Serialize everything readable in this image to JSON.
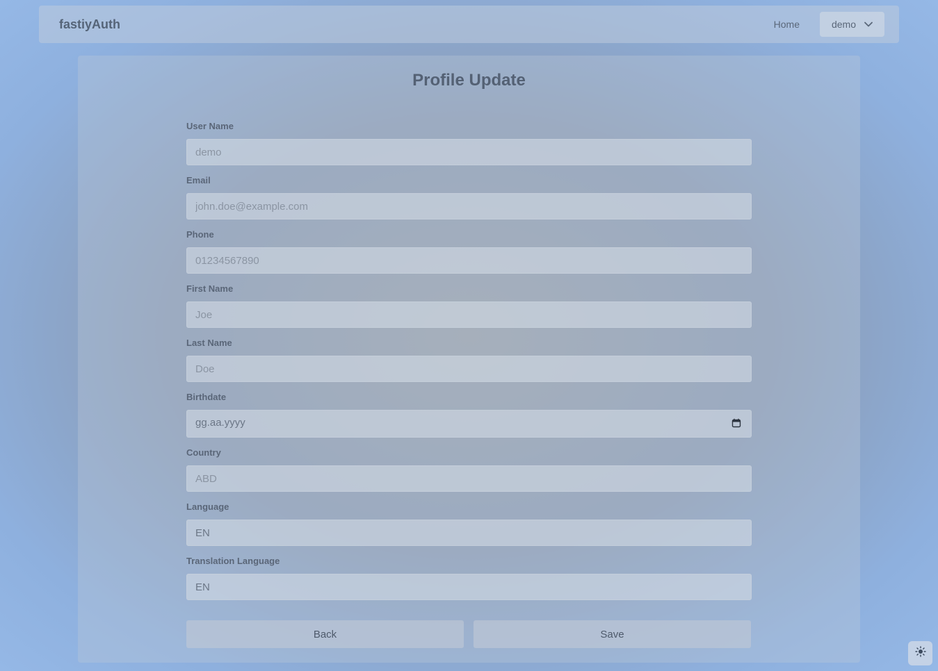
{
  "navbar": {
    "brand": "fastiyAuth",
    "home_label": "Home",
    "user_label": "demo"
  },
  "page": {
    "title": "Profile Update"
  },
  "form": {
    "username": {
      "label": "User Name",
      "placeholder": "demo"
    },
    "email": {
      "label": "Email",
      "placeholder": "john.doe@example.com"
    },
    "phone": {
      "label": "Phone",
      "placeholder": "01234567890"
    },
    "first_name": {
      "label": "First Name",
      "placeholder": "Joe"
    },
    "last_name": {
      "label": "Last Name",
      "placeholder": "Doe"
    },
    "birthdate": {
      "label": "Birthdate",
      "value": "gg.aa.yyyy"
    },
    "country": {
      "label": "Country",
      "placeholder": "ABD"
    },
    "language": {
      "label": "Language",
      "value": "EN"
    },
    "translation_language": {
      "label": "Translation Language",
      "value": "EN"
    }
  },
  "buttons": {
    "back_label": "Back",
    "save_label": "Save"
  },
  "icons": {
    "dropdown": "chevron-down-icon",
    "calendar": "calendar-icon",
    "theme": "sun-icon"
  }
}
